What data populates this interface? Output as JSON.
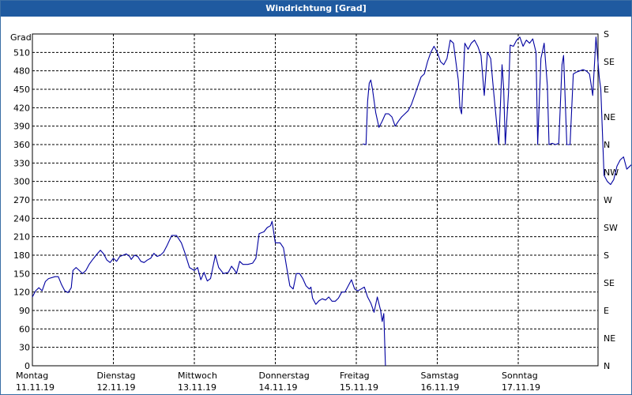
{
  "window": {
    "title": "Windrichtung [Grad]"
  },
  "chart_data": {
    "type": "line",
    "title": "Windrichtung [Grad]",
    "ylabel": "Grad",
    "ylim": [
      0,
      540
    ],
    "yticks": [
      0,
      30,
      60,
      90,
      120,
      150,
      180,
      210,
      240,
      270,
      300,
      330,
      360,
      390,
      420,
      450,
      480,
      510
    ],
    "y2ticks": [
      {
        "value": 0,
        "label": "N"
      },
      {
        "value": 45,
        "label": "NE"
      },
      {
        "value": 90,
        "label": "E"
      },
      {
        "value": 135,
        "label": "SE"
      },
      {
        "value": 180,
        "label": "S"
      },
      {
        "value": 225,
        "label": "SW"
      },
      {
        "value": 270,
        "label": "W"
      },
      {
        "value": 315,
        "label": "NW"
      },
      {
        "value": 360,
        "label": "N"
      },
      {
        "value": 405,
        "label": "NE"
      },
      {
        "value": 450,
        "label": "E"
      },
      {
        "value": 495,
        "label": "SE"
      },
      {
        "value": 540,
        "label": "S"
      }
    ],
    "xlim": [
      0,
      7.05
    ],
    "xticks": [
      {
        "day": "Montag",
        "date": "11.11.19"
      },
      {
        "day": "Dienstag",
        "date": "12.11.19"
      },
      {
        "day": "Mittwoch",
        "date": "13.11.19"
      },
      {
        "day": "Donnerstag",
        "date": "14.11.19"
      },
      {
        "day": "Freitag",
        "date": "15.11.19"
      },
      {
        "day": "Samstag",
        "date": "16.11.19"
      },
      {
        "day": "Sonntag",
        "date": "17.11.19"
      }
    ],
    "grid": true,
    "series": [
      {
        "color": "#0000a0",
        "segments": [
          [
            [
              0.0,
              112
            ],
            [
              0.04,
              122
            ],
            [
              0.08,
              127
            ],
            [
              0.12,
              122
            ],
            [
              0.16,
              137
            ],
            [
              0.2,
              142
            ],
            [
              0.28,
              145
            ],
            [
              0.32,
              145
            ],
            [
              0.36,
              132
            ],
            [
              0.4,
              122
            ],
            [
              0.44,
              119
            ],
            [
              0.48,
              127
            ],
            [
              0.5,
              155
            ],
            [
              0.54,
              160
            ],
            [
              0.58,
              155
            ],
            [
              0.62,
              150
            ],
            [
              0.66,
              155
            ],
            [
              0.7,
              165
            ],
            [
              0.74,
              172
            ],
            [
              0.8,
              182
            ],
            [
              0.84,
              188
            ],
            [
              0.88,
              182
            ],
            [
              0.92,
              172
            ],
            [
              0.96,
              168
            ],
            [
              1.0,
              175
            ],
            [
              1.04,
              170
            ],
            [
              1.08,
              178
            ],
            [
              1.12,
              180
            ],
            [
              1.16,
              182
            ],
            [
              1.2,
              178
            ],
            [
              1.22,
              173
            ],
            [
              1.26,
              180
            ],
            [
              1.3,
              178
            ],
            [
              1.34,
              170
            ],
            [
              1.38,
              168
            ],
            [
              1.42,
              172
            ],
            [
              1.46,
              175
            ],
            [
              1.5,
              183
            ],
            [
              1.54,
              178
            ],
            [
              1.58,
              180
            ],
            [
              1.62,
              185
            ],
            [
              1.66,
              195
            ],
            [
              1.72,
              212
            ],
            [
              1.78,
              212
            ],
            [
              1.84,
              200
            ],
            [
              1.88,
              185
            ],
            [
              1.94,
              160
            ],
            [
              2.0,
              155
            ],
            [
              2.04,
              160
            ],
            [
              2.08,
              140
            ],
            [
              2.12,
              152
            ],
            [
              2.16,
              138
            ],
            [
              2.2,
              142
            ],
            [
              2.26,
              180
            ],
            [
              2.3,
              160
            ],
            [
              2.36,
              150
            ],
            [
              2.42,
              152
            ],
            [
              2.46,
              162
            ],
            [
              2.5,
              155
            ],
            [
              2.52,
              150
            ],
            [
              2.56,
              170
            ],
            [
              2.6,
              165
            ],
            [
              2.66,
              165
            ],
            [
              2.72,
              167
            ],
            [
              2.76,
              175
            ],
            [
              2.8,
              215
            ],
            [
              2.86,
              218
            ],
            [
              2.9,
              225
            ],
            [
              2.94,
              228
            ],
            [
              2.96,
              235
            ],
            [
              3.0,
              200
            ],
            [
              3.06,
              200
            ],
            [
              3.1,
              192
            ],
            [
              3.14,
              160
            ],
            [
              3.18,
              130
            ],
            [
              3.22,
              125
            ],
            [
              3.26,
              150
            ],
            [
              3.3,
              150
            ],
            [
              3.34,
              142
            ],
            [
              3.38,
              130
            ],
            [
              3.42,
              125
            ],
            [
              3.44,
              128
            ],
            [
              3.46,
              110
            ],
            [
              3.5,
              100
            ],
            [
              3.54,
              106
            ],
            [
              3.58,
              109
            ],
            [
              3.62,
              107
            ],
            [
              3.66,
              112
            ],
            [
              3.7,
              105
            ],
            [
              3.74,
              105
            ],
            [
              3.78,
              110
            ],
            [
              3.82,
              120
            ],
            [
              3.86,
              120
            ],
            [
              3.9,
              130
            ],
            [
              3.94,
              140
            ],
            [
              3.98,
              125
            ],
            [
              4.02,
              122
            ],
            [
              4.06,
              125
            ],
            [
              4.1,
              128
            ],
            [
              4.14,
              112
            ],
            [
              4.18,
              102
            ],
            [
              4.22,
              87
            ],
            [
              4.26,
              112
            ],
            [
              4.3,
              90
            ],
            [
              4.32,
              72
            ],
            [
              4.34,
              85
            ],
            [
              4.36,
              0
            ]
          ],
          [
            [
              4.08,
              361
            ],
            [
              4.12,
              360
            ],
            [
              4.14,
              430
            ],
            [
              4.16,
              460
            ],
            [
              4.18,
              465
            ],
            [
              4.2,
              450
            ],
            [
              4.24,
              412
            ],
            [
              4.28,
              388
            ],
            [
              4.32,
              398
            ],
            [
              4.36,
              410
            ],
            [
              4.4,
              410
            ],
            [
              4.44,
              405
            ],
            [
              4.48,
              390
            ],
            [
              4.52,
              398
            ],
            [
              4.56,
              405
            ],
            [
              4.6,
              410
            ],
            [
              4.64,
              415
            ],
            [
              4.68,
              425
            ],
            [
              4.72,
              440
            ],
            [
              4.76,
              455
            ],
            [
              4.8,
              470
            ],
            [
              4.84,
              475
            ],
            [
              4.88,
              495
            ],
            [
              4.92,
              510
            ],
            [
              4.96,
              520
            ],
            [
              5.0,
              510
            ],
            [
              5.04,
              495
            ],
            [
              5.08,
              490
            ],
            [
              5.12,
              500
            ],
            [
              5.16,
              530
            ],
            [
              5.2,
              525
            ],
            [
              5.22,
              505
            ],
            [
              5.26,
              465
            ],
            [
              5.28,
              420
            ],
            [
              5.3,
              410
            ],
            [
              5.34,
              525
            ],
            [
              5.38,
              515
            ],
            [
              5.42,
              525
            ],
            [
              5.46,
              530
            ],
            [
              5.5,
              520
            ],
            [
              5.54,
              505
            ],
            [
              5.58,
              440
            ],
            [
              5.62,
              510
            ],
            [
              5.66,
              500
            ],
            [
              5.7,
              440
            ],
            [
              5.74,
              385
            ],
            [
              5.76,
              360
            ],
            [
              5.8,
              490
            ],
            [
              5.82,
              450
            ],
            [
              5.84,
              360
            ],
            [
              5.88,
              445
            ],
            [
              5.9,
              522
            ],
            [
              5.94,
              520
            ],
            [
              5.98,
              530
            ],
            [
              6.02,
              535
            ],
            [
              6.06,
              520
            ],
            [
              6.1,
              530
            ],
            [
              6.14,
              525
            ],
            [
              6.18,
              532
            ],
            [
              6.22,
              510
            ],
            [
              6.24,
              360
            ],
            [
              6.28,
              500
            ],
            [
              6.32,
              525
            ],
            [
              6.36,
              455
            ],
            [
              6.38,
              360
            ],
            [
              6.42,
              362
            ],
            [
              6.46,
              360
            ],
            [
              6.5,
              362
            ],
            [
              6.54,
              490
            ],
            [
              6.56,
              505
            ],
            [
              6.6,
              360
            ],
            [
              6.64,
              360
            ],
            [
              6.68,
              475
            ],
            [
              6.72,
              478
            ],
            [
              6.76,
              480
            ],
            [
              6.8,
              482
            ],
            [
              6.84,
              480
            ],
            [
              6.88,
              475
            ],
            [
              6.92,
              440
            ],
            [
              6.96,
              535
            ],
            [
              7.0,
              470
            ],
            [
              7.02,
              450
            ]
          ],
          [
            [
              7.02,
              450
            ],
            [
              7.06,
              310
            ],
            [
              7.1,
              300
            ],
            [
              7.14,
              295
            ],
            [
              7.18,
              303
            ],
            [
              7.22,
              325
            ],
            [
              7.26,
              335
            ],
            [
              7.3,
              340
            ],
            [
              7.34,
              320
            ],
            [
              7.38,
              325
            ],
            [
              7.42,
              330
            ],
            [
              7.46,
              332
            ]
          ]
        ]
      }
    ]
  }
}
